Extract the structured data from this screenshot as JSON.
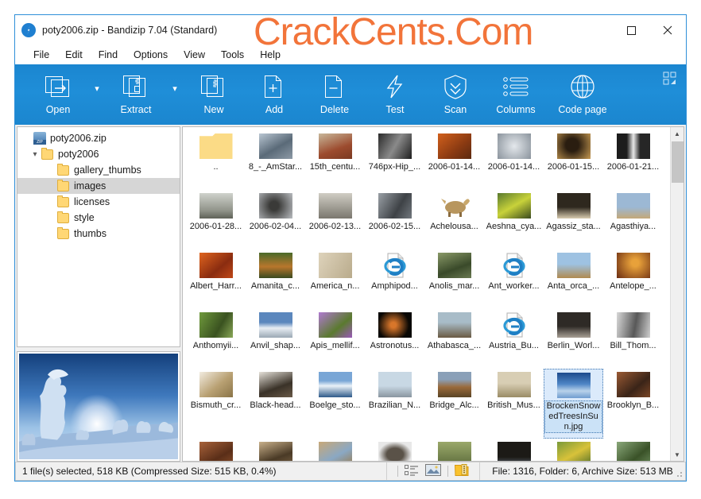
{
  "window": {
    "title": "poty2006.zip - Bandizip 7.04 (Standard)",
    "app_icon": "bandizip-icon",
    "maximize_label": "Maximize",
    "close_label": "Close"
  },
  "watermark": {
    "text": "CrackCents.Com",
    "color": "#f2743a"
  },
  "menubar": {
    "items": [
      {
        "label": "File"
      },
      {
        "label": "Edit"
      },
      {
        "label": "Find"
      },
      {
        "label": "Options"
      },
      {
        "label": "View"
      },
      {
        "label": "Tools"
      },
      {
        "label": "Help"
      }
    ]
  },
  "toolbar": {
    "background": "#1f8ed8",
    "items": [
      {
        "label": "Open",
        "icon": "open-archive-icon",
        "has_caret": true
      },
      {
        "label": "Extract",
        "icon": "extract-icon",
        "has_caret": true
      },
      {
        "label": "New",
        "icon": "new-archive-icon",
        "has_caret": false
      },
      {
        "label": "Add",
        "icon": "add-file-icon",
        "has_caret": false
      },
      {
        "label": "Delete",
        "icon": "delete-file-icon",
        "has_caret": false
      },
      {
        "label": "Test",
        "icon": "test-lightning-icon",
        "has_caret": false
      },
      {
        "label": "Scan",
        "icon": "scan-shield-icon",
        "has_caret": false
      },
      {
        "label": "Columns",
        "icon": "columns-list-icon",
        "has_caret": false
      },
      {
        "label": "Code page",
        "icon": "globe-icon",
        "has_caret": false
      }
    ],
    "grid_button": "layout-grid-icon"
  },
  "tree": {
    "nodes": [
      {
        "label": "poty2006.zip",
        "icon": "zip-icon",
        "indent": 0,
        "expander": "",
        "selected": false
      },
      {
        "label": "poty2006",
        "icon": "folder-icon",
        "indent": 1,
        "expander": "v",
        "selected": false
      },
      {
        "label": "gallery_thumbs",
        "icon": "folder-icon",
        "indent": 2,
        "expander": "",
        "selected": false
      },
      {
        "label": "images",
        "icon": "folder-icon",
        "indent": 2,
        "expander": "",
        "selected": true
      },
      {
        "label": "licenses",
        "icon": "folder-icon",
        "indent": 2,
        "expander": "",
        "selected": false
      },
      {
        "label": "style",
        "icon": "folder-icon",
        "indent": 2,
        "expander": "",
        "selected": false
      },
      {
        "label": "thumbs",
        "icon": "folder-icon",
        "indent": 2,
        "expander": "",
        "selected": false
      }
    ]
  },
  "preview": {
    "name": "image-preview",
    "description": "snow-covered trees at sunrise"
  },
  "grid": {
    "selected_index": 38,
    "items": [
      {
        "label": "..",
        "thumb": "folder"
      },
      {
        "label": "8_-_AmStar...",
        "thumb": "#8a98a8"
      },
      {
        "label": "15th_centu...",
        "thumb": "#a8694e"
      },
      {
        "label": "746px-Hip_...",
        "thumb": "#3a3a3a"
      },
      {
        "label": "2006-01-14...",
        "thumb": "#c0521f"
      },
      {
        "label": "2006-01-14...",
        "thumb": "#9fa7ad"
      },
      {
        "label": "2006-01-15...",
        "thumb": "#a8763c"
      },
      {
        "label": "2006-01-21...",
        "thumb": "#707070"
      },
      {
        "label": "2006-01-28...",
        "thumb": "#a8a89c"
      },
      {
        "label": "2006-02-04...",
        "thumb": "#8c8c8c"
      },
      {
        "label": "2006-02-13...",
        "thumb": "#b0ada4"
      },
      {
        "label": "2006-02-15...",
        "thumb": "#7e8288"
      },
      {
        "label": "Achelousa...",
        "thumb": "#c8b48c"
      },
      {
        "label": "Aeshna_cya...",
        "thumb": "#6e7c3a"
      },
      {
        "label": "Agassiz_sta...",
        "thumb": "#3a3228"
      },
      {
        "label": "Agasthiya...",
        "thumb": "#8fa8c4"
      },
      {
        "label": "Albert_Harr...",
        "thumb": "#b03c16"
      },
      {
        "label": "Amanita_c...",
        "thumb": "#6a5426"
      },
      {
        "label": "America_n...",
        "thumb": "#c8bfa4"
      },
      {
        "label": "Amphipod...",
        "thumb": "ie"
      },
      {
        "label": "Anolis_mar...",
        "thumb": "#6e7a58"
      },
      {
        "label": "Ant_worker...",
        "thumb": "ie"
      },
      {
        "label": "Anta_orca_...",
        "thumb": "#9eb0c4"
      },
      {
        "label": "Antelope_...",
        "thumb": "#7a4a20"
      },
      {
        "label": "Anthomyii...",
        "thumb": "#6f8c3c"
      },
      {
        "label": "Anvil_shap...",
        "thumb": "#7a9cc8"
      },
      {
        "label": "Apis_mellif...",
        "thumb": "#9a7ac0"
      },
      {
        "label": "Astronotus...",
        "thumb": "#1a1208"
      },
      {
        "label": "Athabasca_...",
        "thumb": "#6a6a66"
      },
      {
        "label": "Austria_Bu...",
        "thumb": "ie"
      },
      {
        "label": "Berlin_Worl...",
        "thumb": "#3a3430"
      },
      {
        "label": "Bill_Thom...",
        "thumb": "#a8a8a8"
      },
      {
        "label": "Bismuth_cr...",
        "thumb": "#c8b894"
      },
      {
        "label": "Black-head...",
        "thumb": "#5a5248"
      },
      {
        "label": "Boelge_sto...",
        "thumb": "#4a6c90"
      },
      {
        "label": "Brazilian_N...",
        "thumb": "#a8b8c8"
      },
      {
        "label": "Bridge_Alc...",
        "thumb": "#8e6a42"
      },
      {
        "label": "British_Mus...",
        "thumb": "#b8a888"
      },
      {
        "label": "BrockenSnowedTreesInSun.jpg",
        "thumb": "#4a6ea8"
      },
      {
        "label": "Brooklyn_B...",
        "thumb": "#7a4e34"
      },
      {
        "label": "",
        "thumb": "#8a5436"
      },
      {
        "label": "",
        "thumb": "#6a5a46"
      },
      {
        "label": "",
        "thumb": "#9a8a6a"
      },
      {
        "label": "",
        "thumb": "#6a6258"
      },
      {
        "label": "",
        "thumb": "#8a9a5a"
      },
      {
        "label": "",
        "thumb": "#2a2a26"
      },
      {
        "label": "",
        "thumb": "#8a9a4a"
      },
      {
        "label": "",
        "thumb": "#7a9a6a"
      }
    ]
  },
  "statusbar": {
    "selection_text": "1 file(s) selected, 518 KB (Compressed Size: 515 KB, 0.4%)",
    "icons": [
      {
        "name": "details-view-icon"
      },
      {
        "name": "thumbnail-view-icon"
      },
      {
        "name": "archive-folder-icon"
      }
    ],
    "info_text": "File: 1316, Folder: 6, Archive Size: 513 MB"
  }
}
